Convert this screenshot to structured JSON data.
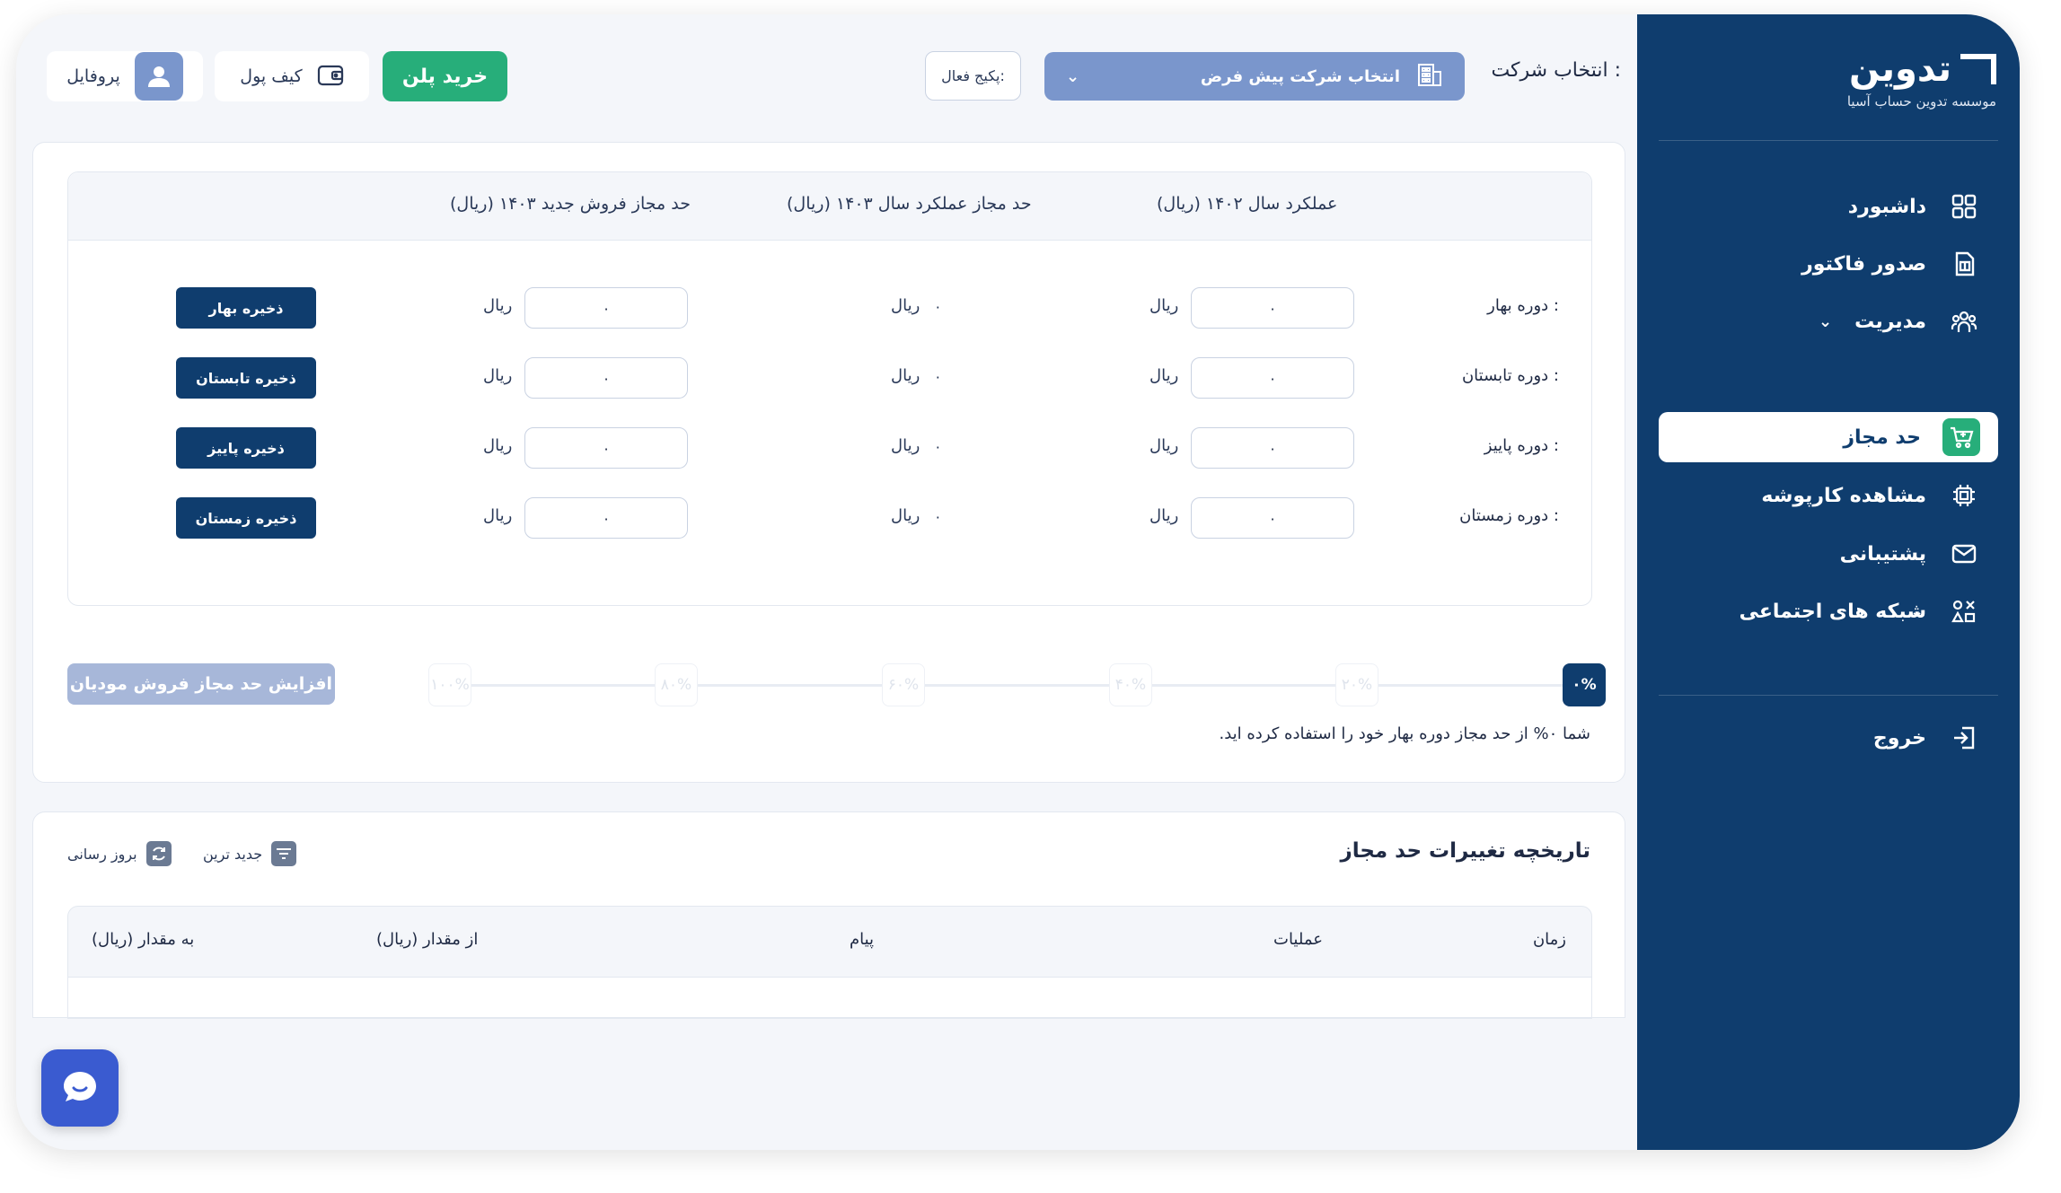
{
  "brand": {
    "logo_text": "تدوین",
    "subtitle": "موسسه تدوین حساب آسیا"
  },
  "sidebar": {
    "items": [
      {
        "label": "داشبورد",
        "icon": "grid-icon"
      },
      {
        "label": "صدور فاکتور",
        "icon": "invoice-icon"
      },
      {
        "label": "مدیریت",
        "icon": "users-icon"
      },
      {
        "label": "حد مجاز",
        "icon": "cart-icon"
      },
      {
        "label": "مشاهده کارپوشه",
        "icon": "chip-icon"
      },
      {
        "label": "پشتیبانی",
        "icon": "mail-icon"
      },
      {
        "label": "شبکه های اجتماعی",
        "icon": "apps-icon"
      }
    ],
    "logout_label": "خروج"
  },
  "header": {
    "company_label": "انتخاب شرکت :",
    "company_value": "انتخاب شرکت پیش فرض",
    "package_label": "پکیج فعال:",
    "buy_label": "خرید پلن",
    "wallet_label": "کیف پول",
    "profile_label": "پروفایل"
  },
  "limits": {
    "columns": {
      "performance_1402": "عملکرد سال ۱۴۰۲ (ریال)",
      "allowed_perf_1403": "حد مجاز عملکرد سال ۱۴۰۳ (ریال)",
      "new_sales_1403": "حد مجاز فروش جدید ۱۴۰۳ (ریال)"
    },
    "unit": "ریال",
    "rows": [
      {
        "label": "دوره بهار :",
        "perf": "۰",
        "allowed": "۰",
        "new": "۰",
        "save": "ذخیره بهار"
      },
      {
        "label": "دوره تابستان :",
        "perf": "۰",
        "allowed": "۰",
        "new": "۰",
        "save": "ذخیره تابستان"
      },
      {
        "label": "دوره پاییز :",
        "perf": "۰",
        "allowed": "۰",
        "new": "۰",
        "save": "ذخیره پاییز"
      },
      {
        "label": "دوره زمستان :",
        "perf": "۰",
        "allowed": "۰",
        "new": "۰",
        "save": "ذخیره زمستان"
      }
    ],
    "progress_marks": [
      "۰%",
      "۲۰%",
      "۴۰%",
      "۶۰%",
      "۸۰%",
      "۱۰۰%"
    ],
    "progress_value": 0,
    "increase_label": "افزایش حد مجاز فروش مودیان",
    "usage_note": "شما ۰% از حد مجاز دوره بهار خود را استفاده کرده اید."
  },
  "history": {
    "title": "تاریخچه تغییرات حد مجاز",
    "newest_label": "جدید ترین",
    "refresh_label": "بروز رسانی",
    "columns": {
      "time": "زمان",
      "operations": "عملیات",
      "message": "پیام",
      "from_amount": "از مقدار (ریال)",
      "to_amount": "به مقدار (ریال)"
    }
  },
  "colors": {
    "sidebar": "#0f3d6e",
    "accent_green": "#27ae7a",
    "select_blue": "#7a96cc"
  }
}
